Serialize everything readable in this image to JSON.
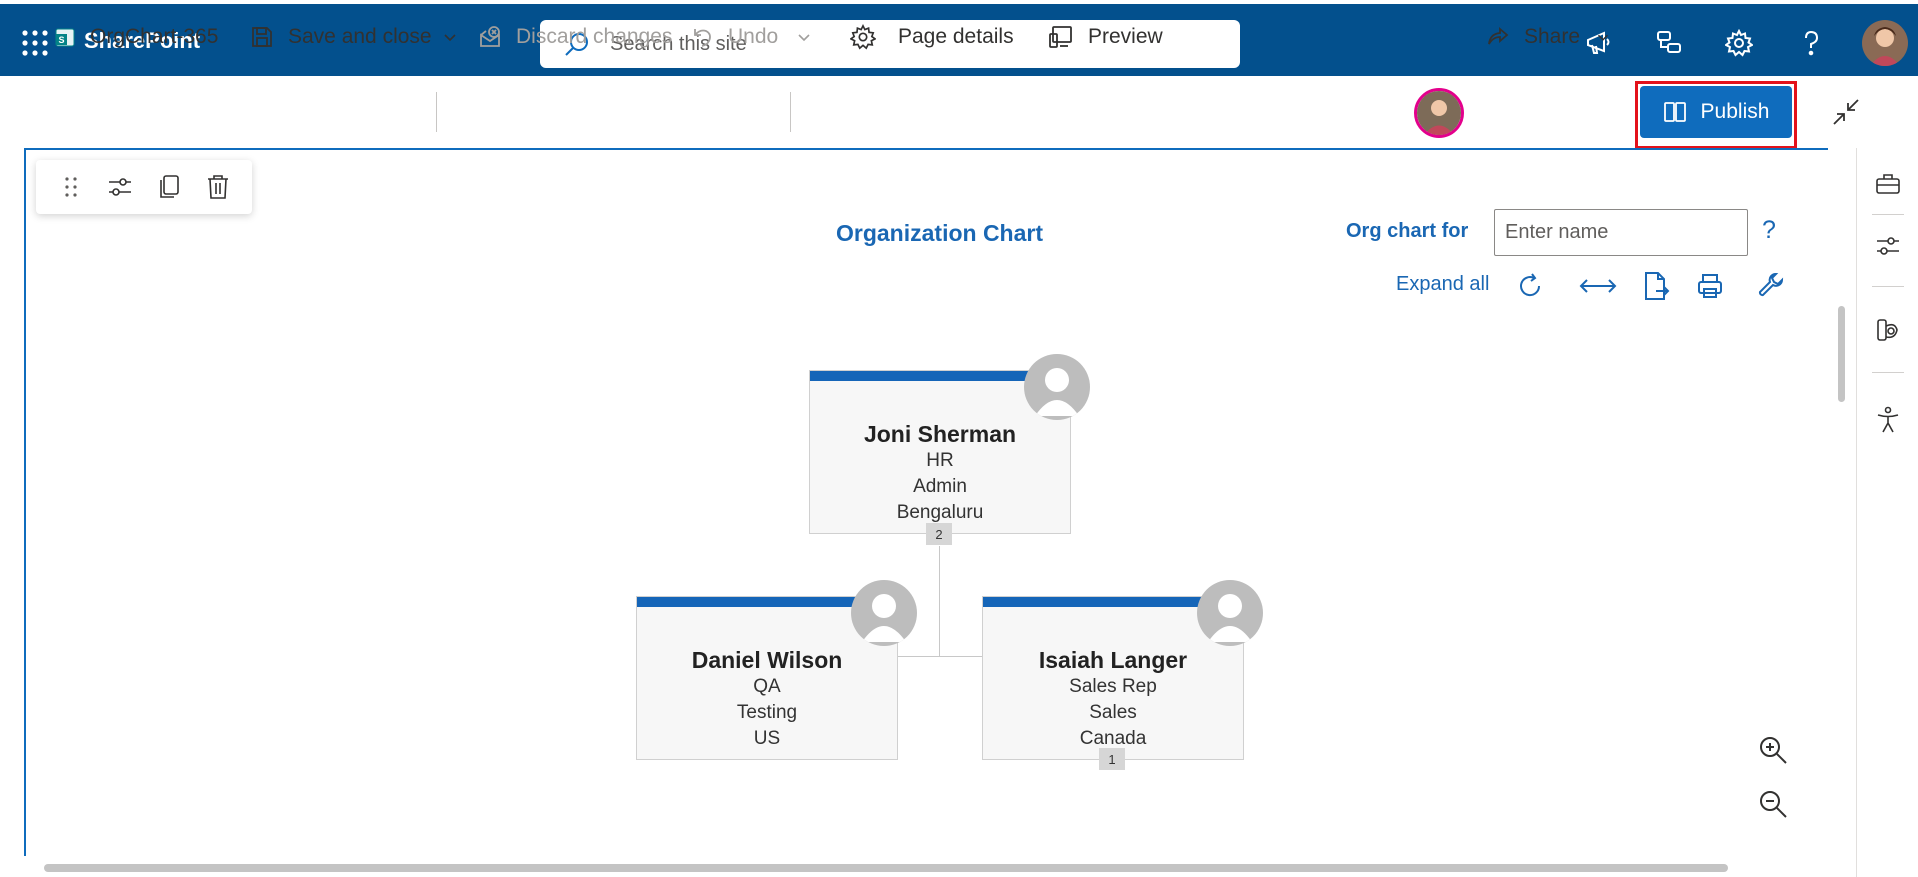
{
  "suite_bar": {
    "app_name": "SharePoint",
    "search_placeholder": "Search this site",
    "icons": [
      "app-launcher-icon",
      "megaphone-icon",
      "feedback-icon",
      "settings-gear-icon",
      "help-question-icon",
      "user-avatar"
    ]
  },
  "command_bar": {
    "page_name": "OrgChart-365",
    "save_and_close": "Save and close",
    "discard_changes": "Discard changes",
    "undo": "Undo",
    "page_details": "Page details",
    "preview": "Preview",
    "share": "Share",
    "publish": "Publish"
  },
  "webpart": {
    "title": "Organization Chart",
    "org_chart_for_label": "Org chart for",
    "name_placeholder": "Enter name",
    "help": "?",
    "expand_all": "Expand all"
  },
  "org_chart": {
    "root": {
      "name": "Joni Sherman",
      "title": "HR",
      "department": "Admin",
      "location": "Bengaluru",
      "reports_count": "2"
    },
    "children": [
      {
        "name": "Daniel Wilson",
        "title": "QA",
        "department": "Testing",
        "location": "US",
        "reports_count": ""
      },
      {
        "name": "Isaiah Langer",
        "title": "Sales Rep",
        "department": "Sales",
        "location": "Canada",
        "reports_count": "1"
      }
    ]
  },
  "colors": {
    "suite_bar": "#03508d",
    "accent": "#0f6cbd",
    "card_header": "#1565b8",
    "highlight_frame": "#e3121b"
  }
}
